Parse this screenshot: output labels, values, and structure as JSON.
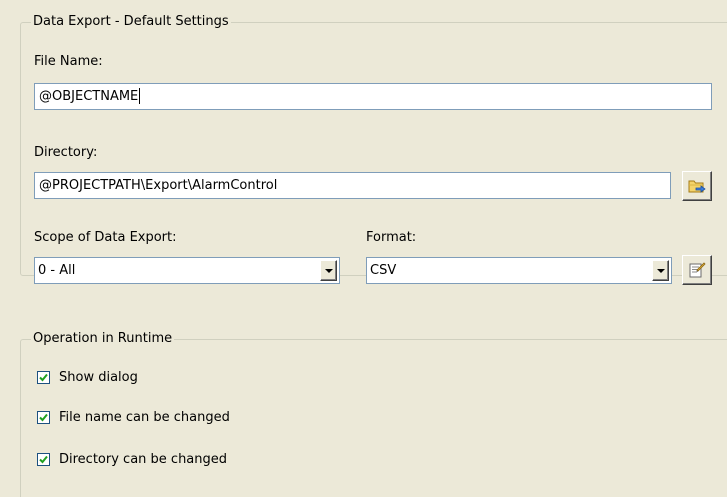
{
  "export_group": {
    "title": "Data Export - Default Settings",
    "file_name": {
      "label": "File Name:",
      "value": "@OBJECTNAME"
    },
    "directory": {
      "label": "Directory:",
      "value": "@PROJECTPATH\\Export\\AlarmControl",
      "browse_icon": "folder-browse-icon"
    },
    "scope": {
      "label": "Scope of Data Export:",
      "selected": "0 - All"
    },
    "format": {
      "label": "Format:",
      "selected": "CSV",
      "settings_icon": "format-settings-icon"
    }
  },
  "runtime_group": {
    "title": "Operation in Runtime",
    "options": [
      {
        "label": "Show dialog",
        "checked": true
      },
      {
        "label": "File name can be changed",
        "checked": true
      },
      {
        "label": "Directory can be changed",
        "checked": true
      }
    ]
  },
  "colors": {
    "panel_background": "#ece9d8",
    "group_border": "#d0d0bf",
    "field_border": "#7f9db9",
    "checkbox_border": "#1c5180"
  }
}
